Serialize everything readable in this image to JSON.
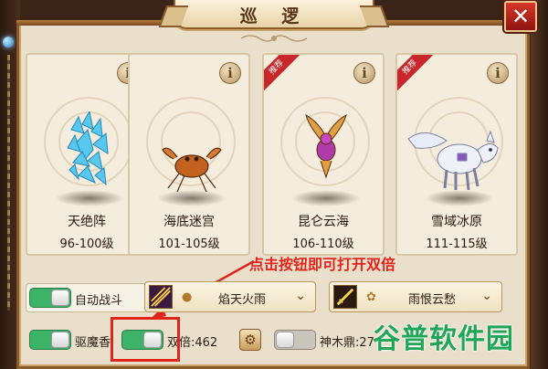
{
  "dialog": {
    "title": "巡 逻",
    "close_glyph": "✕"
  },
  "cards": [
    {
      "name": "天绝阵",
      "level": "96-100级",
      "badge": "",
      "info": "i",
      "creature": "ice-crystal-creature"
    },
    {
      "name": "海底迷宫",
      "level": "101-105级",
      "badge": "",
      "info": "i",
      "creature": "crab-creature"
    },
    {
      "name": "昆仑云海",
      "level": "106-110级",
      "badge": "推荐",
      "info": "i",
      "creature": "phoenix-creature"
    },
    {
      "name": "雪域冰原",
      "level": "111-115级",
      "badge": "推荐",
      "info": "i",
      "creature": "snow-fox-creature"
    }
  ],
  "controls": {
    "auto_battle": {
      "label": "自动战斗",
      "on": true
    },
    "skill_1": {
      "label": "焰天火雨"
    },
    "skill_2": {
      "label": "雨恨云愁"
    },
    "demon_incense": {
      "label": "驱魔香",
      "on": true
    },
    "double": {
      "label": "双倍:462",
      "on": true
    },
    "shennong": {
      "label": "神木鼎:27",
      "on": false
    }
  },
  "annotation": "点击按钮即可打开双倍",
  "watermark": "谷普软件园",
  "colors": {
    "toggle_on": "#3db36a",
    "annotation_red": "#e0241b",
    "watermark_green": "#21a55a",
    "badge_red": "#c8262b"
  }
}
